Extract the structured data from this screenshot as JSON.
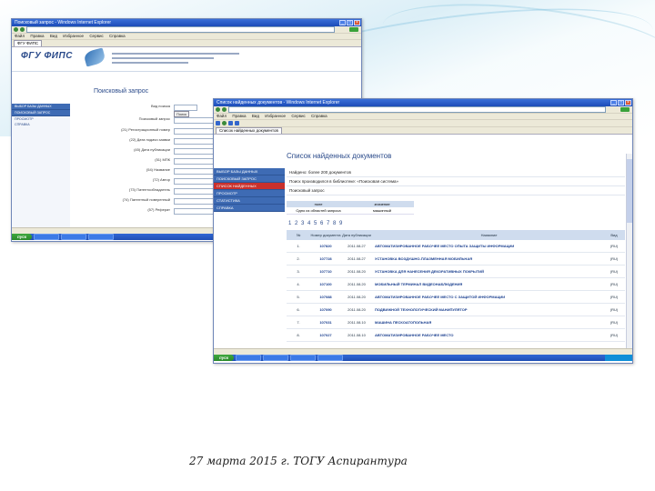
{
  "footer": {
    "caption": "27 марта 2015 г. ТОГУ Аспирантура"
  },
  "window1": {
    "title": "Поисковый запрос - Windows Internet Explorer",
    "menu": [
      "Файл",
      "Правка",
      "Вид",
      "Избранное",
      "Сервис",
      "Справка"
    ],
    "tab": "ФГУ ФИПС",
    "logo": "ФГУ ФИПС",
    "page_title": "Поисковый запрос",
    "nav": [
      "ВЫБОР БАЗЫ ДАННЫХ",
      "ПОИСКОВЫЙ ЗАПРОС",
      "ПРОСМОТР",
      "СПРАВКА"
    ],
    "form_labels": [
      "Вид поиска",
      "Поисковый запрос",
      "(21) Регистрационный номер",
      "(22) Дата подачи заявки",
      "(45) Дата публикации",
      "(51) МПК",
      "(54) Название",
      "(72) Автор",
      "(73) Патентообладатель",
      "(74) Патентный поверенный",
      "(57) Реферат"
    ],
    "form_button": "Поиск"
  },
  "window2": {
    "title": "Список найденных документов - Windows Internet Explorer",
    "menu": [
      "Файл",
      "Правка",
      "Вид",
      "Избранное",
      "Сервис",
      "Справка"
    ],
    "tab": "Список найденных документов",
    "page_title": "Список найденных документов",
    "nav": [
      "ВЫБОР БАЗЫ ДАННЫХ",
      "ПОИСКОВЫЙ ЗАПРОС",
      "СПИСОК НАЙДЕННЫХ",
      "ПРОСМОТР",
      "СТАТИСТИКА",
      "СПРАВКА"
    ],
    "info_lines": [
      "Найдено: более 200 документов",
      "Поиск производился в библиотеке: «Поисковая система»",
      "Поисковый запрос"
    ],
    "small_table": {
      "headers": [
        "поле",
        "значение"
      ],
      "row": [
        "Одно из областей запроса",
        "машинный"
      ]
    },
    "pager": "1 2 3 4 5 6 7 8 9",
    "table_headers": [
      "№",
      "Номер документа",
      "Дата публикации",
      "Название",
      "Вид"
    ],
    "rows": [
      {
        "num": "1.",
        "doc": "107820",
        "date": "2011.08.27",
        "name": "АВТОМАТИЗИРОВАННОЕ РАБОЧЕЕ МЕСТО ОПЫТА ЗАЩИТЫ ИНФОРМАЦИИ",
        "type": "(RU)"
      },
      {
        "num": "2.",
        "doc": "107728",
        "date": "2011.08.27",
        "name": "УСТАНОВКА ВОЗДУШНО-ПЛАЗМЕННАЯ МОБИЛЬНАЯ",
        "type": "(RU)"
      },
      {
        "num": "3.",
        "doc": "107710",
        "date": "2011.08.20",
        "name": "УСТАНОВКА ДЛЯ НАНЕСЕНИЯ ДЕКОРАТИВНЫХ ПОКРЫТИЙ",
        "type": "(RU)"
      },
      {
        "num": "4.",
        "doc": "107100",
        "date": "2011.08.20",
        "name": "МОБИЛЬНЫЙ ТЕРМИНАЛ ВИДЕОНАБЛЮДЕНИЯ",
        "type": "(RU)"
      },
      {
        "num": "5.",
        "doc": "107088",
        "date": "2011.08.20",
        "name": "АВТОМАТИЗИРОВАННОЕ РАБОЧЕЕ МЕСТО С ЗАЩИТОЙ ИНФОРМАЦИИ",
        "type": "(RU)"
      },
      {
        "num": "6.",
        "doc": "107090",
        "date": "2011.08.20",
        "name": "ПОДВИЖНОЙ ТЕХНОЛОГИЧЕСКИЙ МАНИПУЛЯТОР",
        "type": "(RU)"
      },
      {
        "num": "7.",
        "doc": "107031",
        "date": "2011.08.10",
        "name": "МАШИНА ПЕСКОАТОПОЛЬНАЯ",
        "type": "(RU)"
      },
      {
        "num": "8.",
        "doc": "107027",
        "date": "2011.08.10",
        "name": "АВТОМАТИЗИРОВАННОЕ РАБОЧЕЕ МЕСТО",
        "type": "(RU)"
      }
    ]
  },
  "taskbar": {
    "start": "пуск"
  }
}
